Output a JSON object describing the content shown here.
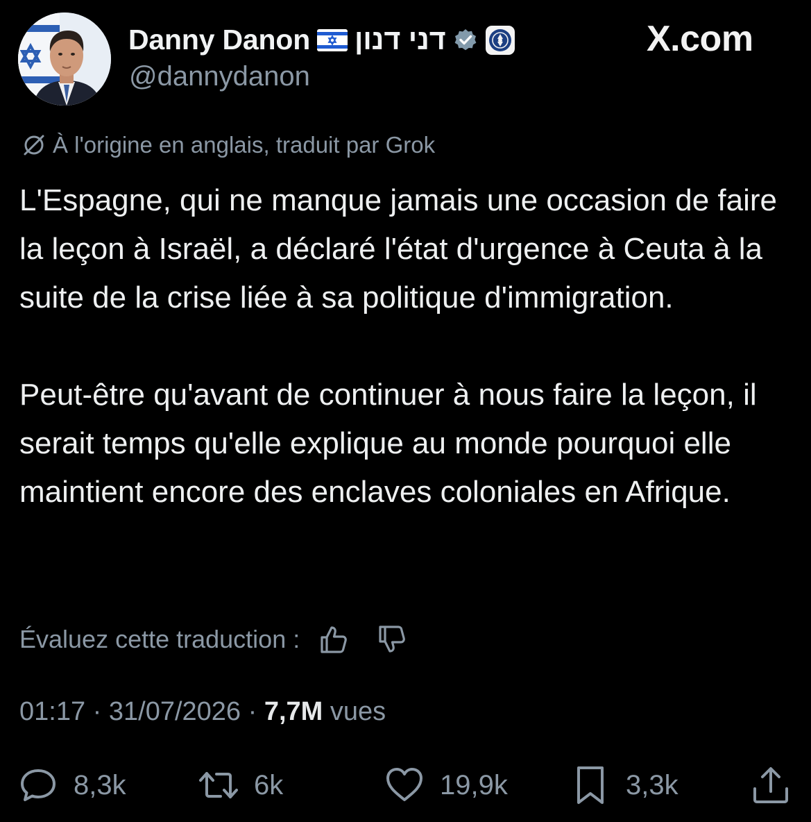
{
  "author": {
    "display_name": "Danny Danon",
    "hebrew_name": "דני דנון",
    "handle": "@dannydanon",
    "verified_color": "#829aab"
  },
  "site": {
    "label": "X.com"
  },
  "translation_notice": "À l'origine en anglais, traduit par Grok",
  "tweet": {
    "paragraphs": [
      "L'Espagne, qui ne manque jamais une occasion de faire la leçon à Israël, a déclaré l'état d'urgence à Ceuta à la suite de la crise liée à sa politique d'immigration.",
      "Peut-être qu'avant de continuer à nous faire la leçon, il serait temps qu'elle explique au monde pourquoi elle maintient encore des enclaves coloniales en Afrique."
    ]
  },
  "rate_translation": {
    "label": "Évaluez cette traduction :",
    "icons": [
      "thumbs-up-icon",
      "thumbs-down-icon"
    ]
  },
  "meta": {
    "time": "01:17",
    "separator": "·",
    "date": "31/07/2026",
    "views_count": "7,7M",
    "views_label": "vues"
  },
  "actions": {
    "reply_count": "8,3k",
    "repost_count": "6k",
    "like_count": "19,9k",
    "bookmark_count": "3,3k"
  },
  "colors": {
    "background": "#000000",
    "primary_text": "#e7e9ea",
    "secondary_text": "#8b98a5"
  }
}
